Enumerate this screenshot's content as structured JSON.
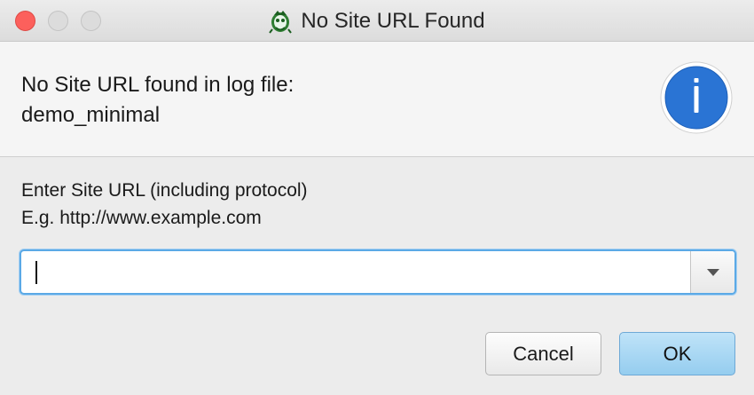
{
  "window": {
    "title": "No Site URL Found",
    "title_icon": "app-frog-icon"
  },
  "message": {
    "line1": "No Site URL found in log file:",
    "line2": "demo_minimal",
    "icon": "info-icon"
  },
  "prompt": {
    "line1": "Enter Site URL (including protocol)",
    "line2": "E.g. http://www.example.com"
  },
  "url_field": {
    "value": "",
    "dropdown_icon": "chevron-down-icon"
  },
  "buttons": {
    "cancel": "Cancel",
    "ok": "OK"
  },
  "colors": {
    "close": "#fc605c",
    "focus_ring": "#5ba9e6",
    "default_button": "#95cdef",
    "info_blue": "#2a74d4"
  }
}
